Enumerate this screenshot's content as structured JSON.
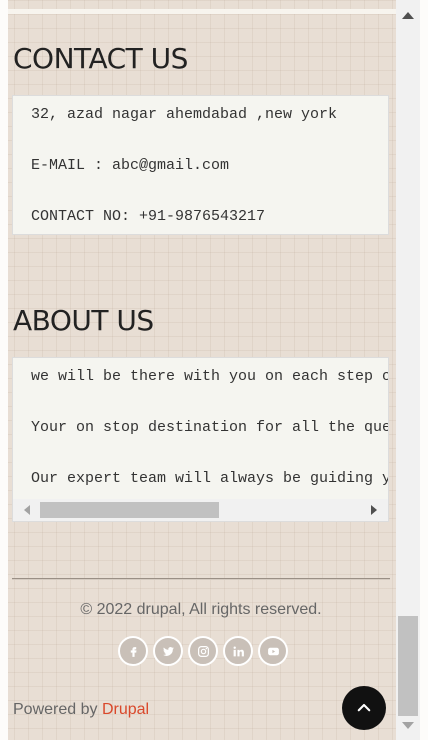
{
  "contact": {
    "title": "CONTACT US",
    "lines": [
      "32, azad nagar ahemdabad ,new york",
      "E-MAIL : abc@gmail.com",
      "CONTACT NO: +91-9876543217"
    ]
  },
  "about": {
    "title": "ABOUT US",
    "lines": [
      "we will be there with you on each step of",
      "Your on stop destination for all the quer",
      "Our expert team will always be guiding yo"
    ]
  },
  "footer": {
    "copyright": "© 2022 drupal, All rights reserved.",
    "social": [
      {
        "name": "facebook-icon",
        "glyph": "f"
      },
      {
        "name": "twitter-icon",
        "glyph": "t"
      },
      {
        "name": "instagram-icon",
        "glyph": "ig"
      },
      {
        "name": "linkedin-icon",
        "glyph": "in"
      },
      {
        "name": "youtube-icon",
        "glyph": "yt"
      }
    ],
    "powered_prefix": "Powered by ",
    "powered_link": "Drupal"
  },
  "colors": {
    "background": "#e8ded4",
    "link": "#d9482b",
    "back_to_top": "#111111"
  }
}
